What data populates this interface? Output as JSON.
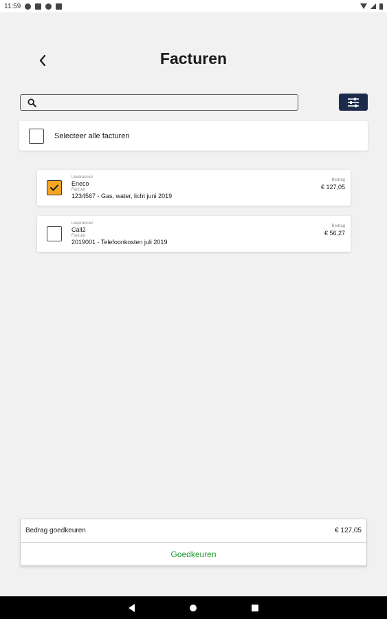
{
  "status_bar": {
    "time": "11:59",
    "icons": [
      "notification-a-icon",
      "notification-b-icon",
      "notification-c-icon",
      "notification-d-icon"
    ],
    "right_icons": [
      "wifi-icon",
      "signal-icon",
      "battery-icon"
    ]
  },
  "header": {
    "title": "Facturen",
    "back_icon": "chevron-left-icon"
  },
  "search": {
    "value": "",
    "placeholder": "",
    "icon": "search-icon"
  },
  "filter": {
    "icon": "sliders-icon",
    "color": "#1c2b4a"
  },
  "select_all": {
    "label": "Selecteer alle facturen",
    "checked": false
  },
  "invoices": [
    {
      "checked": true,
      "supplier_label": "Leverancier",
      "supplier": "Eneco",
      "invoice_label": "Factuur",
      "invoice": "1234567 - Gas, water, licht juni 2019",
      "amount_label": "Bedrag",
      "amount": "€ 127,05"
    },
    {
      "checked": false,
      "supplier_label": "Leverancier",
      "supplier": "Call2",
      "invoice_label": "Factuur",
      "invoice": "2019001 - Telefoonkosten juli 2019",
      "amount_label": "Bedrag",
      "amount": "€ 56,27"
    }
  ],
  "summary": {
    "label": "Bedrag goedkeuren",
    "amount": "€ 127,05",
    "approve_label": "Goedkeuren",
    "approve_color": "#1f9a2e"
  },
  "colors": {
    "checkbox_checked": "#f5a623",
    "background": "#f1f1f1"
  },
  "nav": {
    "icons": [
      "nav-back-icon",
      "nav-home-icon",
      "nav-recent-icon"
    ]
  }
}
